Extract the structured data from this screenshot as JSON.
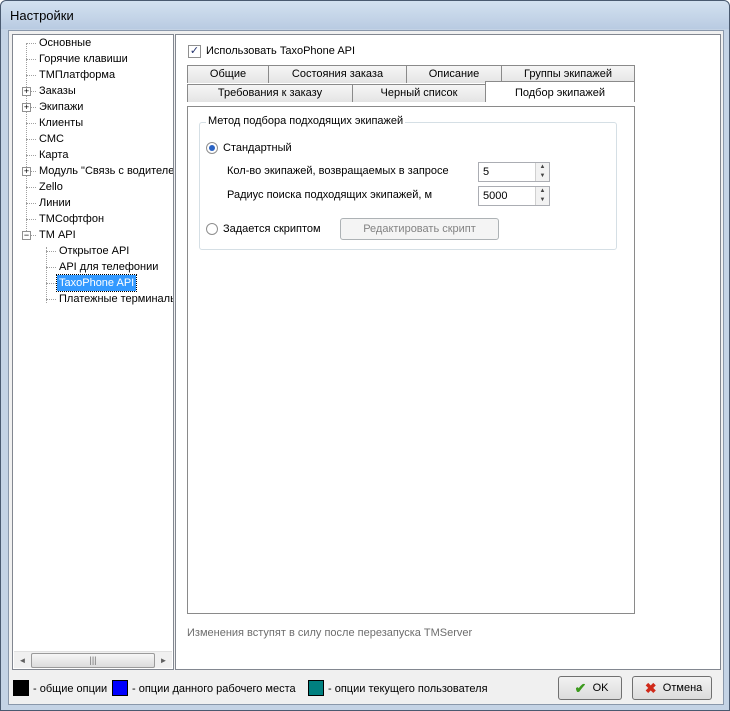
{
  "window": {
    "title": "Настройки"
  },
  "tree": {
    "items": [
      {
        "label": "Основные"
      },
      {
        "label": "Горячие клавиши"
      },
      {
        "label": "ТМПлатформа"
      },
      {
        "label": "Заказы",
        "expander": "+"
      },
      {
        "label": "Экипажи",
        "expander": "+"
      },
      {
        "label": "Клиенты"
      },
      {
        "label": "СМС"
      },
      {
        "label": "Карта"
      },
      {
        "label": "Модуль \"Связь с водителем\"",
        "expander": "+"
      },
      {
        "label": "Zello"
      },
      {
        "label": "Линии"
      },
      {
        "label": "ТМСофтфон"
      },
      {
        "label": "ТМ API",
        "expander": "−"
      },
      {
        "label": "Открытое API"
      },
      {
        "label": "API для телефонии"
      },
      {
        "label": "TaxoPhone API",
        "selected": true
      },
      {
        "label": "Платежные терминалы"
      }
    ],
    "scroll_left": "◄",
    "scroll_right": "►",
    "scroll_grip": "|||"
  },
  "panel": {
    "enable_label": "Использовать TaxoPhone API",
    "enable_checked": true,
    "check_glyph": "✓",
    "tabs_row1": [
      "Общие",
      "Состояния заказа",
      "Описание",
      "Группы экипажей"
    ],
    "tabs_row2": [
      "Требования к заказу",
      "Черный список",
      "Подбор экипажей"
    ],
    "active_tab": "Подбор экипажей",
    "group_title": "Метод подбора подходящих экипажей",
    "radio_standard": "Стандартный",
    "count_label": "Кол-во экипажей, возвращаемых в запросе",
    "count_value": "5",
    "radius_label": "Радиус поиска подходящих экипажей, м",
    "radius_value": "5000",
    "radio_script": "Задается скриптом",
    "edit_script_button": "Редактировать скрипт",
    "spin_up": "▲",
    "spin_down": "▼",
    "note": "Изменения вступят в силу после перезапуска TMServer"
  },
  "footer": {
    "legend": [
      {
        "color": "#000000",
        "label": "- общие опции"
      },
      {
        "color": "#0000ff",
        "label": "- опции данного рабочего места"
      },
      {
        "color": "#008080",
        "label": "- опции текущего пользователя"
      }
    ],
    "ok_label": "OK",
    "cancel_label": "Отмена",
    "ok_icon": "✔",
    "cancel_icon": "✖"
  }
}
